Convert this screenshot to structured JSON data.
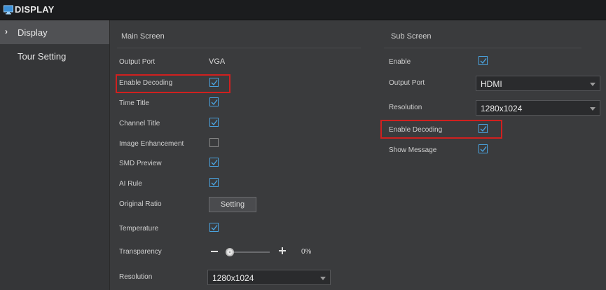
{
  "window": {
    "title": "DISPLAY",
    "icon": "monitor-icon"
  },
  "sidebar": {
    "items": [
      {
        "label": "Display",
        "active": true
      },
      {
        "label": "Tour Setting",
        "active": false
      }
    ]
  },
  "main_screen": {
    "title": "Main Screen",
    "output_port": {
      "label": "Output Port",
      "value": "VGA"
    },
    "enable_decoding": {
      "label": "Enable Decoding",
      "checked": true
    },
    "time_title": {
      "label": "Time Title",
      "checked": true
    },
    "channel_title": {
      "label": "Channel Title",
      "checked": true
    },
    "image_enhancement": {
      "label": "Image Enhancement",
      "checked": false
    },
    "smd_preview": {
      "label": "SMD Preview",
      "checked": true
    },
    "ai_rule": {
      "label": "AI Rule",
      "checked": true
    },
    "original_ratio": {
      "label": "Original Ratio",
      "button": "Setting"
    },
    "temperature": {
      "label": "Temperature",
      "checked": true
    },
    "transparency": {
      "label": "Transparency",
      "value_text": "0%",
      "value": 0
    },
    "resolution": {
      "label": "Resolution",
      "value": "1280x1024"
    }
  },
  "sub_screen": {
    "title": "Sub Screen",
    "enable": {
      "label": "Enable",
      "checked": true
    },
    "output_port": {
      "label": "Output Port",
      "value": "HDMI"
    },
    "resolution": {
      "label": "Resolution",
      "value": "1280x1024"
    },
    "enable_decoding": {
      "label": "Enable Decoding",
      "checked": true
    },
    "show_message": {
      "label": "Show Message",
      "checked": true
    }
  },
  "colors": {
    "accent": "#4aa3df",
    "highlight": "#d0201f",
    "background": "#3a3b3d"
  }
}
